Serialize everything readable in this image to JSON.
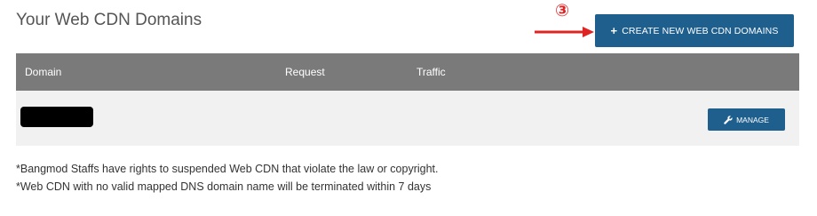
{
  "page": {
    "title": "Your Web CDN Domains"
  },
  "annotation": {
    "number": "③",
    "color": "#e02424"
  },
  "create_button": {
    "icon": "plus-icon",
    "icon_glyph": "+",
    "label": "CREATE NEW WEB CDN DOMAINS",
    "color": "#1f5f8e"
  },
  "table": {
    "columns": [
      "Domain",
      "Request",
      "Traffic"
    ],
    "header_color": "#7a7a7a",
    "rows": [
      {
        "domain": "",
        "domain_redacted": true,
        "request": "",
        "traffic": "",
        "manage_label": "MANAGE",
        "manage_icon": "wrench-icon"
      }
    ]
  },
  "notes": [
    "*Bangmod Staffs have rights to suspended Web CDN that violate the law or copyright.",
    "*Web CDN with no valid mapped DNS domain name will be terminated within 7 days"
  ]
}
